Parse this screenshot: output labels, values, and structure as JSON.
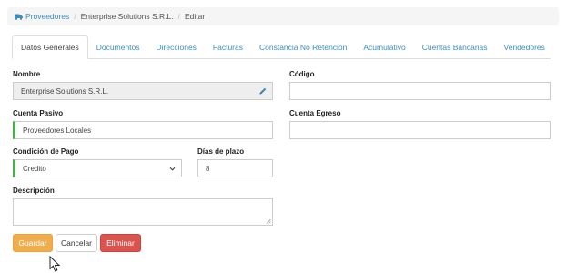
{
  "breadcrumb": {
    "icon": "truck-icon",
    "root": "Proveedores",
    "item": "Enterprise Solutions S.R.L.",
    "current": "Editar"
  },
  "tabs": [
    {
      "label": "Datos Generales",
      "active": true
    },
    {
      "label": "Documentos",
      "active": false
    },
    {
      "label": "Direcciones",
      "active": false
    },
    {
      "label": "Facturas",
      "active": false
    },
    {
      "label": "Constancia No Retención",
      "active": false
    },
    {
      "label": "Acumulativo",
      "active": false
    },
    {
      "label": "Cuentas Bancarias",
      "active": false
    },
    {
      "label": "Vendedores",
      "active": false
    }
  ],
  "form": {
    "nombre": {
      "label": "Nombre",
      "value": "Enterprise Solutions S.R.L."
    },
    "codigo": {
      "label": "Código",
      "value": ""
    },
    "cuenta_pasivo": {
      "label": "Cuenta Pasivo",
      "value": "Proveedores Locales"
    },
    "cuenta_egreso": {
      "label": "Cuenta Egreso",
      "value": ""
    },
    "condicion_pago": {
      "label": "Condición de Pago",
      "value": "Credito"
    },
    "dias_plazo": {
      "label": "Días de plazo",
      "value": "8"
    },
    "descripcion": {
      "label": "Descripción",
      "value": ""
    }
  },
  "buttons": {
    "save": "Guardar",
    "cancel": "Cancelar",
    "delete": "Eliminar"
  },
  "colors": {
    "link": "#3c8dbc",
    "save": "#f0ad4e",
    "delete": "#d9534f",
    "required": "#4cae4c"
  }
}
